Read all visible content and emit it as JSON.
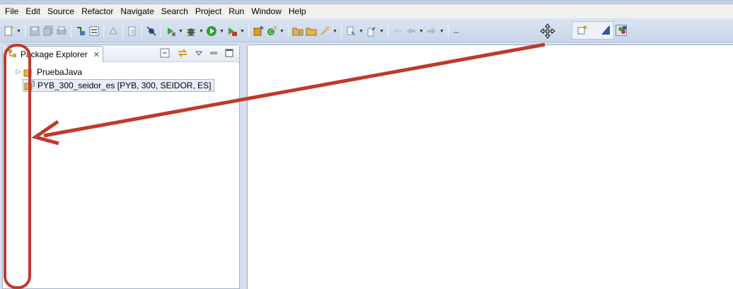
{
  "menubar": {
    "items": [
      "File",
      "Edit",
      "Source",
      "Refactor",
      "Navigate",
      "Search",
      "Project",
      "Run",
      "Window",
      "Help"
    ]
  },
  "toolbar": {
    "icons": [
      "new-icon",
      "save-icon",
      "save-all-icon",
      "print-icon",
      "run-on-server-icon",
      "toggle-mark-icon",
      "open-task-icon",
      "open-type-icon",
      "skip-breakpoints-icon",
      "run-icon",
      "debug-icon",
      "run-last-icon",
      "external-tools-icon",
      "new-java-package-icon",
      "new-java-class-icon",
      "open-folder-icon",
      "open-file-icon",
      "search-icon",
      "next-annotation-icon",
      "previous-annotation-icon",
      "back-icon",
      "forward-icon"
    ],
    "perspective_icons": [
      "open-perspective-icon",
      "java-ee-perspective-icon",
      "java-perspective-icon"
    ]
  },
  "package_explorer": {
    "tab_label": "Package Explorer",
    "projects": [
      {
        "name": "PruebaJava",
        "expandable": true,
        "selected": false
      },
      {
        "name": "PYB_300_seidor_es [PYB, 300, SEIDOR, ES]",
        "expandable": false,
        "selected": true
      }
    ]
  },
  "colors": {
    "annotation": "#c0392b",
    "frame_bg": "#d6dfee",
    "selection_bg": "#e8eef8"
  }
}
